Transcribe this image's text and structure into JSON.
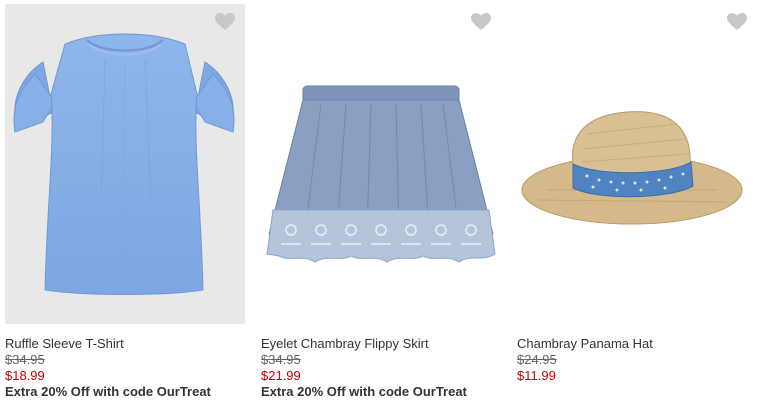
{
  "products": [
    {
      "name": "Ruffle Sleeve T-Shirt",
      "original_price": "$34.95",
      "sale_price": "$18.99",
      "promo": "Extra 20% Off with code OurTreat",
      "image": "light-blue-ruffle-sleeve-top",
      "favorite_icon": "heart-icon"
    },
    {
      "name": "Eyelet Chambray Flippy Skirt",
      "original_price": "$34.95",
      "sale_price": "$21.99",
      "promo": "Extra 20% Off with code OurTreat",
      "image": "chambray-eyelet-skirt",
      "favorite_icon": "heart-icon"
    },
    {
      "name": "Chambray Panama Hat",
      "original_price": "$24.95",
      "sale_price": "$11.99",
      "image": "straw-panama-hat",
      "favorite_icon": "heart-icon"
    }
  ],
  "colors": {
    "sale_price": "#d00000",
    "text": "#333333",
    "heart": "#c8c8c8"
  }
}
